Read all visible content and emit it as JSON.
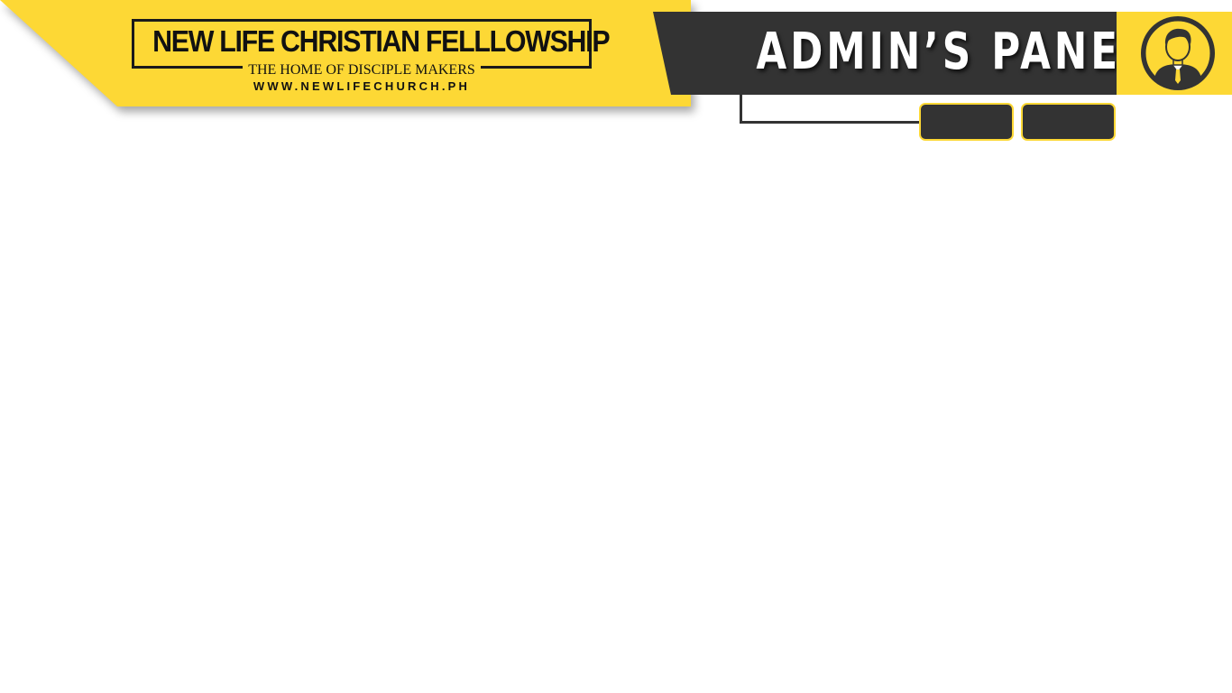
{
  "brand": {
    "name": "NEW LIFE CHRISTIAN FELLLOWSHIP",
    "tagline": "THE HOME OF DISCIPLE MAKERS",
    "url": "WWW.NEWLIFECHURCH.PH"
  },
  "header": {
    "title": "ADMIN’S PANEL"
  },
  "user": {
    "avatar_icon": "user-avatar-icon"
  },
  "nav": {
    "buttons": [
      {
        "label": ""
      },
      {
        "label": ""
      }
    ]
  },
  "colors": {
    "accent": "#fdd835",
    "dark": "#333333",
    "text": "#111111",
    "background": "#ffffff"
  }
}
